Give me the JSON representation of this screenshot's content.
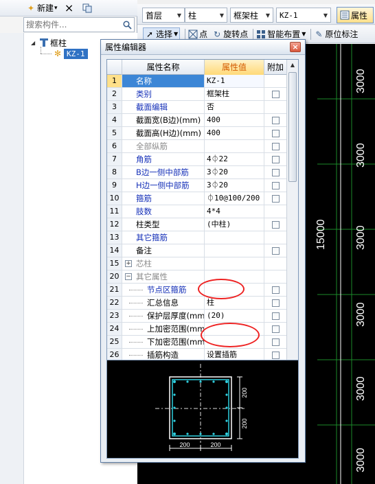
{
  "left_toolbar": {
    "new_label": "新建",
    "new_dropdown": "▾",
    "delete_icon": "×",
    "copy_icon": "copy"
  },
  "search": {
    "placeholder": "搜索构件..."
  },
  "tree": {
    "root_label": "框柱",
    "child_label": "KZ-1"
  },
  "toolbar1": {
    "floor": "首层",
    "type": "柱",
    "subtype": "框架柱",
    "component": "KZ-1",
    "properties_button": "属性"
  },
  "toolbar2": {
    "select": "选择",
    "point": "点",
    "rotate_point": "旋转点",
    "smart_layout": "智能布置",
    "origin_mark": "原位标注"
  },
  "canvas": {
    "dimensions": [
      "3000",
      "3000",
      "3000",
      "15000",
      "3000",
      "3000",
      "3000"
    ]
  },
  "property_editor": {
    "title": "属性编辑器",
    "close": "×",
    "headers": {
      "name": "属性名称",
      "value": "属性值",
      "add": "附加"
    },
    "rows": [
      {
        "idx": "1",
        "name": "名称",
        "value": "KZ-1",
        "style": "blue",
        "check": false,
        "selected": true
      },
      {
        "idx": "2",
        "name": "类别",
        "value": "框架柱",
        "style": "blue",
        "check": true
      },
      {
        "idx": "3",
        "name": "截面编辑",
        "value": "否",
        "style": "blue",
        "check": false
      },
      {
        "idx": "4",
        "name": "截面宽(B边)(mm)",
        "value": "400",
        "style": "black",
        "check": true
      },
      {
        "idx": "5",
        "name": "截面高(H边)(mm)",
        "value": "400",
        "style": "black",
        "check": true
      },
      {
        "idx": "6",
        "name": "全部纵筋",
        "value": "",
        "style": "gray",
        "check": true
      },
      {
        "idx": "7",
        "name": "角筋",
        "value": "4⏀22",
        "style": "blue",
        "check": true
      },
      {
        "idx": "8",
        "name": "B边一侧中部筋",
        "value": "3⏀20",
        "style": "blue",
        "check": true
      },
      {
        "idx": "9",
        "name": "H边一侧中部筋",
        "value": "3⏀20",
        "style": "blue",
        "check": true
      },
      {
        "idx": "10",
        "name": "箍筋",
        "value": "⏀10@100/200",
        "style": "blue",
        "check": true
      },
      {
        "idx": "11",
        "name": "肢数",
        "value": "4*4",
        "style": "blue",
        "check": false
      },
      {
        "idx": "12",
        "name": "柱类型",
        "value": "(中柱)",
        "style": "black",
        "check": true
      },
      {
        "idx": "13",
        "name": "其它箍筋",
        "value": "",
        "style": "blue",
        "check": false
      },
      {
        "idx": "14",
        "name": "备注",
        "value": "",
        "style": "black",
        "check": true
      },
      {
        "idx": "15",
        "name": "芯柱",
        "value": "",
        "style": "gray",
        "check": false,
        "expander": "+"
      },
      {
        "idx": "20",
        "name": "其它属性",
        "value": "",
        "style": "gray",
        "check": false,
        "expander": "−"
      },
      {
        "idx": "21",
        "name": "节点区箍筋",
        "value": "",
        "style": "blue",
        "check": true,
        "child": true
      },
      {
        "idx": "22",
        "name": "汇总信息",
        "value": "柱",
        "style": "black",
        "check": true,
        "child": true
      },
      {
        "idx": "23",
        "name": "保护层厚度(mm)",
        "value": "(20)",
        "style": "black",
        "check": true,
        "child": true
      },
      {
        "idx": "24",
        "name": "上加密范围(mm)",
        "value": "",
        "style": "black",
        "check": true,
        "child": true
      },
      {
        "idx": "25",
        "name": "下加密范围(mm)",
        "value": "",
        "style": "black",
        "check": true,
        "child": true
      },
      {
        "idx": "26",
        "name": "插筋构造",
        "value": "设置插筋",
        "style": "black",
        "check": true,
        "child": true
      }
    ]
  },
  "preview": {
    "dim_b1": "200",
    "dim_b2": "200",
    "dim_h1": "200",
    "dim_h2": "200"
  },
  "colors": {
    "canvas_bg": "#000000",
    "grid_line": "#1b8a2a",
    "section_outline": "#2fd0e0",
    "annotation": "#e22222"
  }
}
